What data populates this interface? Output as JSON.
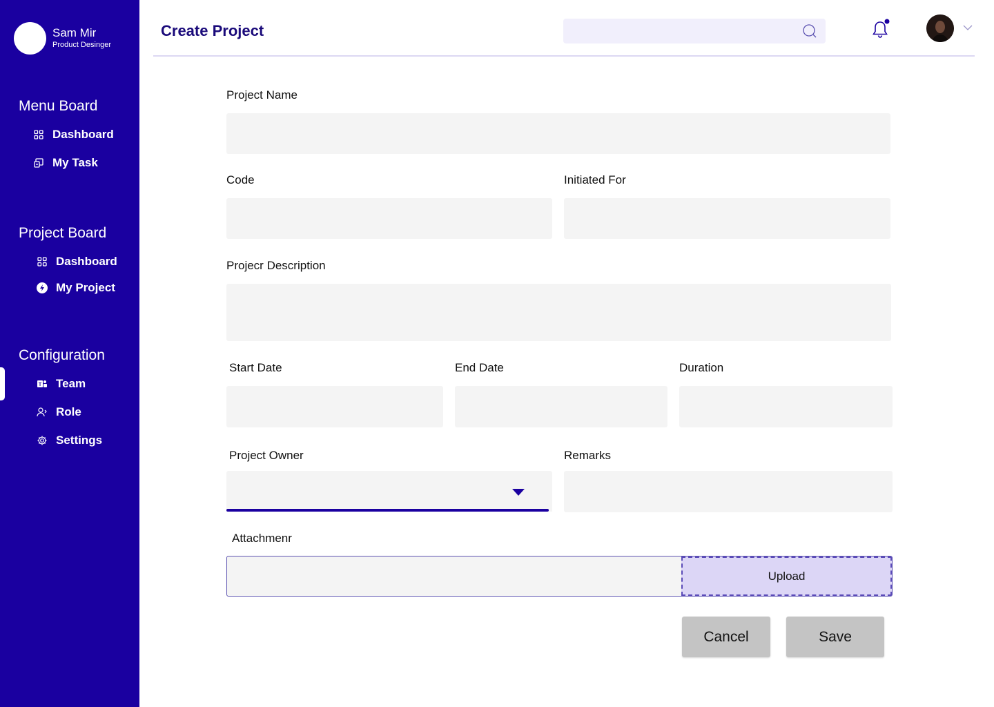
{
  "user": {
    "name": "Sam Mir",
    "role": "Product Desinger"
  },
  "sidebar": {
    "sections": [
      {
        "title": "Menu Board",
        "items": [
          {
            "label": "Dashboard",
            "icon": "grid-icon"
          },
          {
            "label": "My Task",
            "icon": "task-icon"
          }
        ]
      },
      {
        "title": "Project Board",
        "items": [
          {
            "label": "Dashboard",
            "icon": "grid-icon"
          },
          {
            "label": "My Project",
            "icon": "bolt-icon"
          }
        ]
      },
      {
        "title": "Configuration",
        "items": [
          {
            "label": "Team",
            "icon": "team-icon"
          },
          {
            "label": "Role",
            "icon": "user-role-icon"
          },
          {
            "label": "Settings",
            "icon": "gear-icon"
          }
        ]
      }
    ],
    "active_item": "Team"
  },
  "header": {
    "title": "Create Project",
    "search_placeholder": ""
  },
  "form": {
    "project_name": {
      "label": "Project Name",
      "value": ""
    },
    "code": {
      "label": "Code",
      "value": ""
    },
    "initiated_for": {
      "label": "Initiated For",
      "value": ""
    },
    "description": {
      "label": "Projecr Description",
      "value": ""
    },
    "start_date": {
      "label": "Start Date",
      "value": ""
    },
    "end_date": {
      "label": "End Date",
      "value": ""
    },
    "duration": {
      "label": "Duration",
      "value": ""
    },
    "project_owner": {
      "label": "Project Owner",
      "selected": ""
    },
    "remarks": {
      "label": "Remarks",
      "value": ""
    },
    "attachment": {
      "label": "Attachmenr",
      "upload_label": "Upload"
    }
  },
  "actions": {
    "cancel_label": "Cancel",
    "save_label": "Save"
  },
  "colors": {
    "sidebar_bg": "#1a00a0",
    "title": "#1a0a7a",
    "field_bg": "#f4f4f4",
    "upload_bg": "#dcd6f6",
    "button_bg": "#c4c4c4"
  }
}
